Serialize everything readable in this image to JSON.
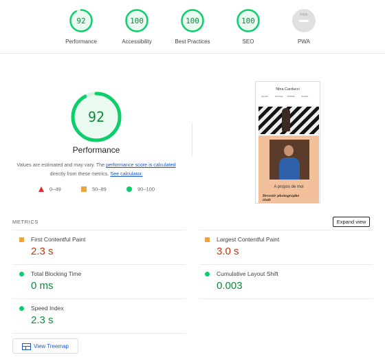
{
  "summary_gauges": [
    {
      "value": "92",
      "label": "Performance",
      "score": 0.92,
      "color": "#0cce6b"
    },
    {
      "value": "100",
      "label": "Accessibility",
      "score": 1.0,
      "color": "#0cce6b"
    },
    {
      "value": "100",
      "label": "Best Practices",
      "score": 1.0,
      "color": "#0cce6b"
    },
    {
      "value": "100",
      "label": "SEO",
      "score": 1.0,
      "color": "#0cce6b"
    },
    {
      "value": "PWA",
      "label": "PWA",
      "color": "#9e9e9e"
    }
  ],
  "performance": {
    "score": "92",
    "score_fraction": 0.92,
    "title": "Performance",
    "desc_before": "Values are estimated and may vary. The ",
    "desc_link1": "performance score is calculated",
    "desc_middle": " directly from these metrics. ",
    "desc_link2": "See calculator."
  },
  "legend": [
    {
      "icon": "fail-triangle-icon",
      "range": "0–49",
      "color": "#e52b2b"
    },
    {
      "icon": "average-square-icon",
      "range": "50–89",
      "color": "#f2a33a"
    },
    {
      "icon": "pass-circle-icon",
      "range": "90–100",
      "color": "#0cce6b"
    }
  ],
  "screenshot": {
    "site_name": "Nina Carducci",
    "nav_items": [
      "Accueil",
      "Services",
      "Portfolio",
      "Contact"
    ],
    "section_title": "A propos de moi",
    "tagline": "Devenir photographe était"
  },
  "metrics": {
    "title": "METRICS",
    "expand_label": "Expand view",
    "items": [
      {
        "label": "First Contentful Paint",
        "value": "2.3 s",
        "status": "average"
      },
      {
        "label": "Largest Contentful Paint",
        "value": "3.0 s",
        "status": "average"
      },
      {
        "label": "Total Blocking Time",
        "value": "0 ms",
        "status": "pass"
      },
      {
        "label": "Cumulative Layout Shift",
        "value": "0.003",
        "status": "pass"
      },
      {
        "label": "Speed Index",
        "value": "2.3 s",
        "status": "pass"
      }
    ]
  },
  "treemap": {
    "label": "View Treemap"
  }
}
